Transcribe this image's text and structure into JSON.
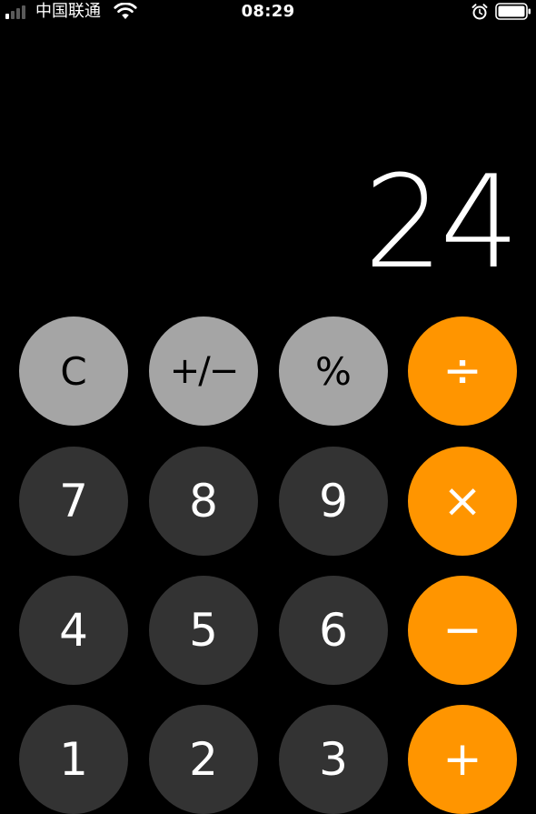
{
  "status_bar": {
    "carrier": "中国联通",
    "time": "08:29",
    "signal_bars_active": 1,
    "signal_bars_total": 4,
    "icons": [
      "signal-icon",
      "wifi-icon",
      "alarm-icon",
      "battery-icon"
    ],
    "battery_level": 1.0
  },
  "display": {
    "value": "24"
  },
  "keys": {
    "row1": [
      "C",
      "+/−",
      "%",
      "÷"
    ],
    "row2": [
      "7",
      "8",
      "9",
      "×"
    ],
    "row3": [
      "4",
      "5",
      "6",
      "−"
    ],
    "row4": [
      "1",
      "2",
      "3",
      "+"
    ]
  },
  "colors": {
    "background": "#000000",
    "function_key": "#a5a5a5",
    "number_key": "#333333",
    "operator_key": "#ff9500"
  }
}
